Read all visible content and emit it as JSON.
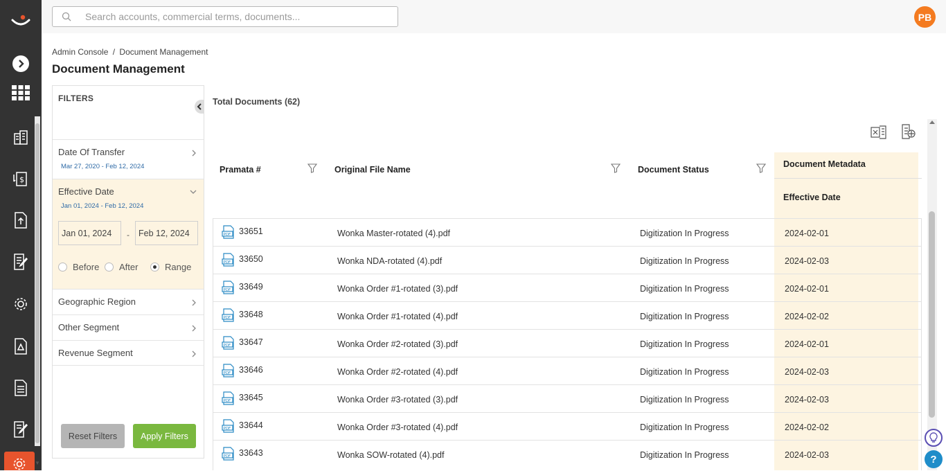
{
  "search": {
    "placeholder": "Search accounts, commercial terms, documents..."
  },
  "user": {
    "initials": "PB"
  },
  "breadcrumb": {
    "root": "Admin Console",
    "separator": "/",
    "current": "Document Management"
  },
  "page_title": "Document Management",
  "filters": {
    "title": "FILTERS",
    "items": [
      {
        "label": "Date Of Transfer",
        "range": "Mar 27, 2020 - Feb 12, 2024",
        "expanded": false
      },
      {
        "label": "Effective Date",
        "range": "Jan 01, 2024 - Feb 12, 2024",
        "expanded": true,
        "from": "Jan 01, 2024",
        "to": "Feb 12, 2024",
        "options": [
          "Before",
          "After",
          "Range"
        ],
        "selected": "Range"
      },
      {
        "label": "Geographic Region"
      },
      {
        "label": "Other Segment"
      },
      {
        "label": "Revenue Segment"
      }
    ],
    "date_separator": "-",
    "reset_label": "Reset Filters",
    "apply_label": "Apply Filters"
  },
  "total_label": "Total Documents (62)",
  "table": {
    "columns": {
      "pramata": "Pramata #",
      "file": "Original File Name",
      "status": "Document Status",
      "metadata_group": "Document Metadata",
      "effective_date": "Effective Date"
    },
    "rows": [
      {
        "id": "33651",
        "file": "Wonka Master-rotated (4).pdf",
        "status": "Digitization In Progress",
        "date": "2024-02-01"
      },
      {
        "id": "33650",
        "file": "Wonka NDA-rotated (4).pdf",
        "status": "Digitization In Progress",
        "date": "2024-02-03"
      },
      {
        "id": "33649",
        "file": "Wonka Order #1-rotated (3).pdf",
        "status": "Digitization In Progress",
        "date": "2024-02-01"
      },
      {
        "id": "33648",
        "file": "Wonka Order #1-rotated (4).pdf",
        "status": "Digitization In Progress",
        "date": "2024-02-02"
      },
      {
        "id": "33647",
        "file": "Wonka Order #2-rotated (3).pdf",
        "status": "Digitization In Progress",
        "date": "2024-02-01"
      },
      {
        "id": "33646",
        "file": "Wonka Order #2-rotated (4).pdf",
        "status": "Digitization In Progress",
        "date": "2024-02-03"
      },
      {
        "id": "33645",
        "file": "Wonka Order #3-rotated (3).pdf",
        "status": "Digitization In Progress",
        "date": "2024-02-03"
      },
      {
        "id": "33644",
        "file": "Wonka Order #3-rotated (4).pdf",
        "status": "Digitization In Progress",
        "date": "2024-02-02"
      },
      {
        "id": "33643",
        "file": "Wonka SOW-rotated (4).pdf",
        "status": "Digitization In Progress",
        "date": "2024-02-03"
      }
    ],
    "file_icon_label": "PDF"
  },
  "colors": {
    "rail": "#333333",
    "accent_orange": "#f47b20",
    "apply_green": "#7ab83f",
    "highlight": "#fdf4e1",
    "link_blue": "#2e6aa6",
    "pdf_blue": "#2a8ac4"
  },
  "icons": {
    "rail": [
      "logo-icon",
      "expand-arrow-icon",
      "apps-grid-icon",
      "buildings-icon",
      "money-transfer-icon",
      "document-upload-icon",
      "document-edit-icon",
      "settings-gear-icon",
      "document-alert-icon",
      "document-list-icon",
      "document-sign-icon",
      "admin-gear-icon"
    ],
    "toolbar": [
      "excel-export-icon",
      "column-settings-icon"
    ],
    "floating": [
      "lightbulb-icon",
      "help-icon"
    ]
  }
}
